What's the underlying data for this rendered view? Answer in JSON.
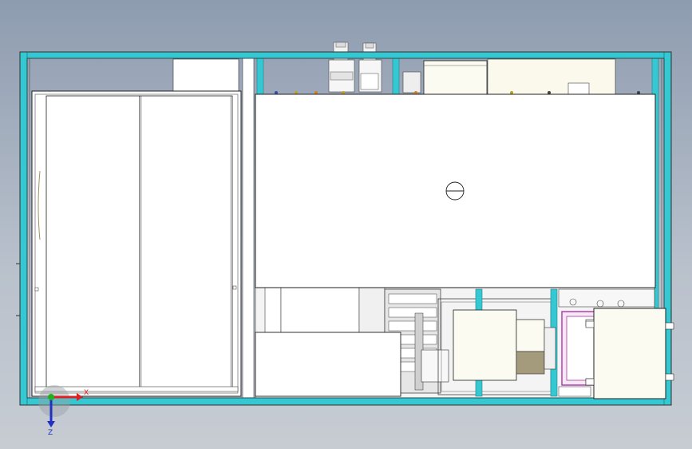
{
  "viewport": {
    "background_top": "#8e9cb0",
    "background_bottom": "#c7ccd3",
    "frame_color": "#35c8d2",
    "panel_fill": "#ffffff",
    "stroke_color": "#303030"
  },
  "triad": {
    "x_label": "X",
    "z_label": "Z",
    "x_color": "#e02020",
    "z_color": "#2030c0",
    "origin_color": "#20b020"
  }
}
